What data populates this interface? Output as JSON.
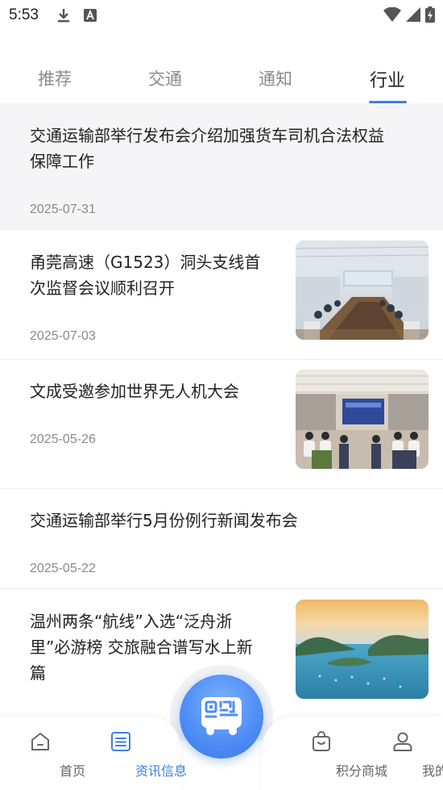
{
  "status_bar": {
    "time": "5:53"
  },
  "tabs": [
    {
      "label": "推荐"
    },
    {
      "label": "交通"
    },
    {
      "label": "通知"
    },
    {
      "label": "行业",
      "active": true
    }
  ],
  "feed": [
    {
      "title_line1": "交通运输部举行发布会介绍加强货车司机合法权益",
      "title_line2": "保障工作",
      "title_line3": "",
      "date": "2025-07-31",
      "has_image": false
    },
    {
      "title_line1": "甬莞高速（G1523）洞头支线首",
      "title_line2": "次监督会议顺利召开",
      "title_line3": "",
      "date": "2025-07-03",
      "has_image": true,
      "image": "meeting-room-photo"
    },
    {
      "title_line1": "文成受邀参加世界无人机大会",
      "title_line2": "",
      "title_line3": "",
      "date": "2025-05-26",
      "has_image": true,
      "image": "conference-hall-photo"
    },
    {
      "title_line1": "交通运输部举行5月份例行新闻发布会",
      "title_line2": "",
      "title_line3": "",
      "date": "2025-05-22",
      "has_image": false
    },
    {
      "title_line1": "温州两条“航线”入选“泛舟浙",
      "title_line2": "里”必游榜  交旅融合谱写水上新",
      "title_line3": "篇",
      "date": "",
      "has_image": true,
      "image": "island-sea-photo"
    }
  ],
  "bottom_nav": {
    "home": "首页",
    "news": "资讯信息",
    "mall": "积分商城",
    "mine": "我的",
    "center_button": "bus-qr-icon"
  },
  "colors": {
    "accent": "#3d7fe0",
    "text": "#222222",
    "muted": "#8a8a8a"
  }
}
